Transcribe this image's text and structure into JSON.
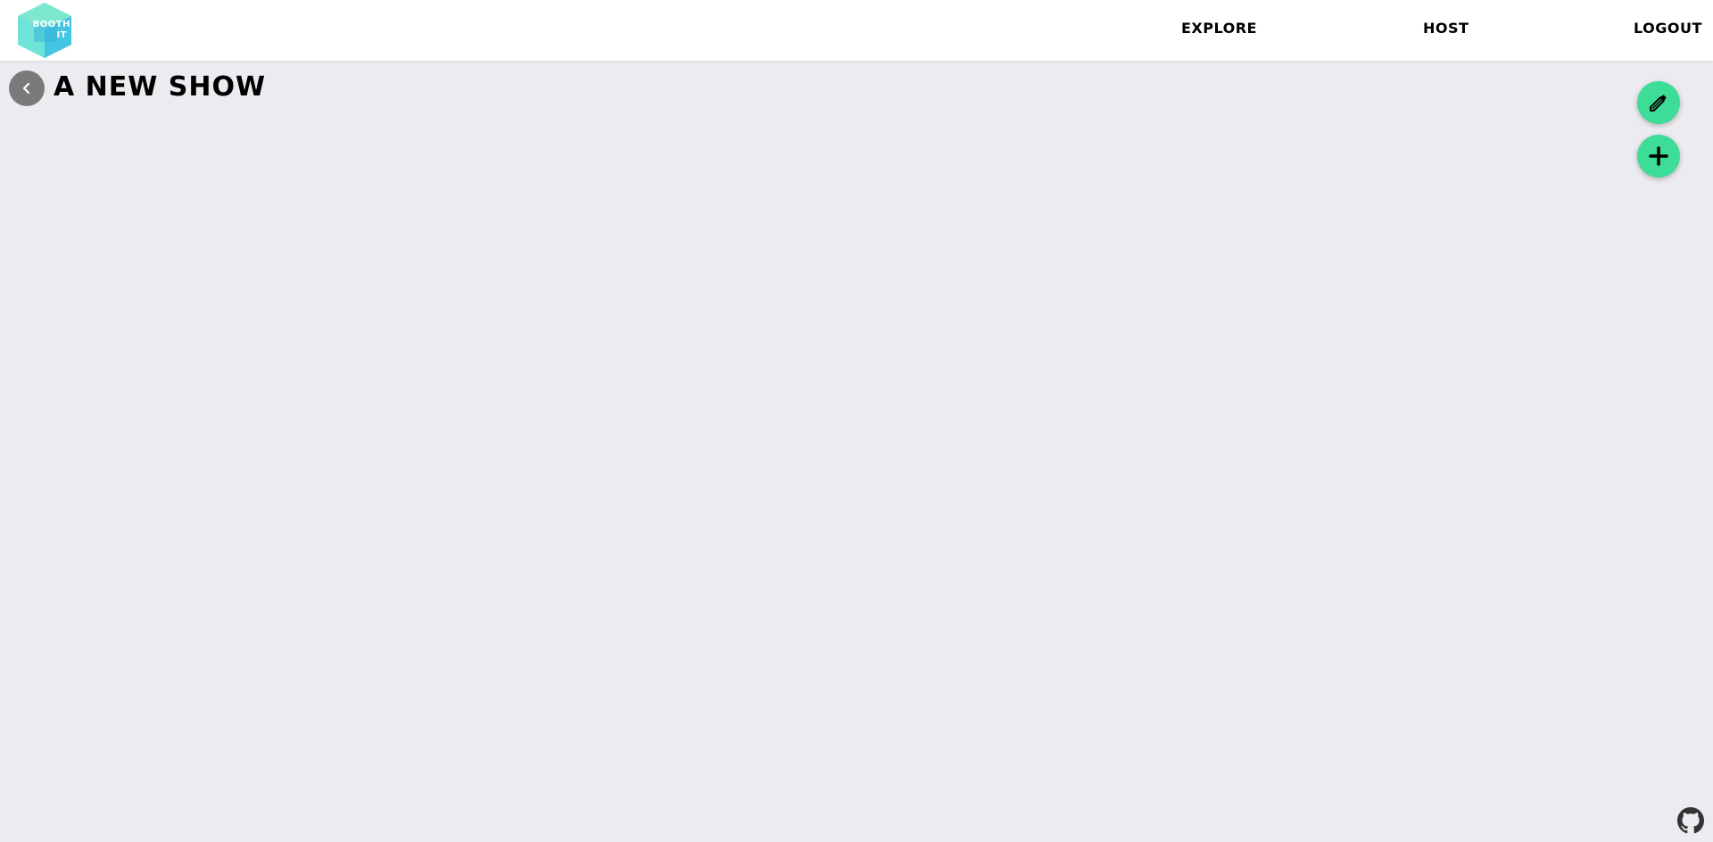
{
  "brand": {
    "logo_line1": "BOOTH",
    "logo_line2": "IT",
    "colors": {
      "hex_light": "#7be8cf",
      "hex_mid": "#5fd9e6",
      "hex_dark": "#3dbfe0"
    }
  },
  "nav": {
    "items": [
      {
        "label": "EXPLORE"
      },
      {
        "label": "HOST"
      },
      {
        "label": "LOGOUT"
      }
    ]
  },
  "page": {
    "title": "A NEW SHOW",
    "back_icon": "chevron-left-icon"
  },
  "actions": {
    "edit_icon": "pencil-icon",
    "add_icon": "plus-icon",
    "accent_color": "#3ddc97"
  },
  "footer": {
    "github_icon": "github-icon"
  }
}
